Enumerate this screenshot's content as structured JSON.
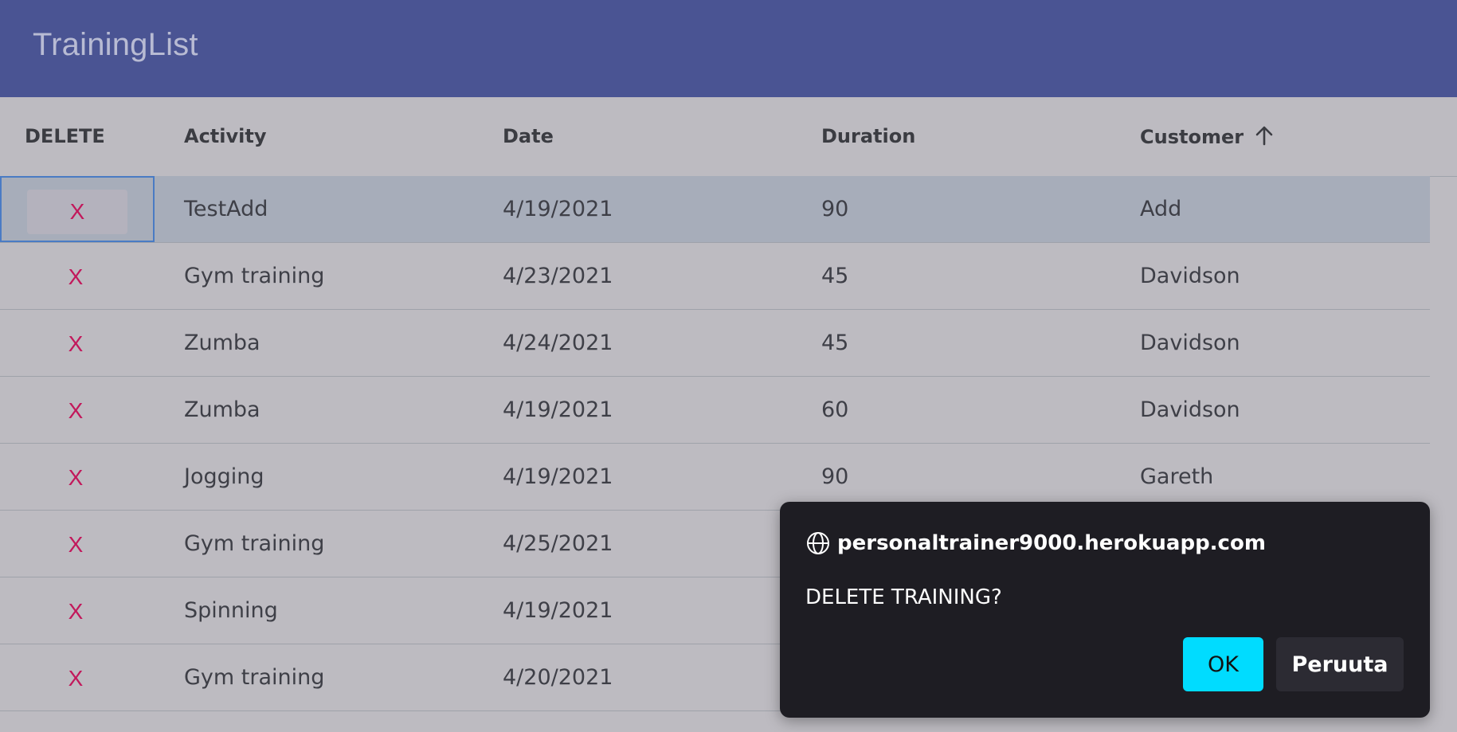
{
  "app": {
    "title": "TrainingList"
  },
  "columns": [
    {
      "key": "delete",
      "label": "DELETE"
    },
    {
      "key": "activity",
      "label": "Activity"
    },
    {
      "key": "date",
      "label": "Date"
    },
    {
      "key": "duration",
      "label": "Duration"
    },
    {
      "key": "customer",
      "label": "Customer",
      "sort": "ascending"
    }
  ],
  "rows": [
    {
      "delete": "X",
      "activity": "TestAdd",
      "date": "4/19/2021",
      "duration": "90",
      "customer": "Add",
      "selected": true
    },
    {
      "delete": "X",
      "activity": "Gym training",
      "date": "4/23/2021",
      "duration": "45",
      "customer": "Davidson"
    },
    {
      "delete": "X",
      "activity": "Zumba",
      "date": "4/24/2021",
      "duration": "45",
      "customer": "Davidson"
    },
    {
      "delete": "X",
      "activity": "Zumba",
      "date": "4/19/2021",
      "duration": "60",
      "customer": "Davidson"
    },
    {
      "delete": "X",
      "activity": "Jogging",
      "date": "4/19/2021",
      "duration": "90",
      "customer": "Gareth"
    },
    {
      "delete": "X",
      "activity": "Gym training",
      "date": "4/25/2021",
      "duration": "",
      "customer": ""
    },
    {
      "delete": "X",
      "activity": "Spinning",
      "date": "4/19/2021",
      "duration": "",
      "customer": ""
    },
    {
      "delete": "X",
      "activity": "Gym training",
      "date": "4/20/2021",
      "duration": "",
      "customer": ""
    }
  ],
  "dialog": {
    "origin": "personaltrainer9000.herokuapp.com",
    "message": "DELETE TRAINING?",
    "ok_label": "OK",
    "cancel_label": "Peruuta",
    "icon": "globe-icon"
  },
  "colors": {
    "appbar": "#4a5493",
    "delete_accent": "#c2185b",
    "ok_button": "#00dcff",
    "dialog_bg": "#1e1d23"
  }
}
